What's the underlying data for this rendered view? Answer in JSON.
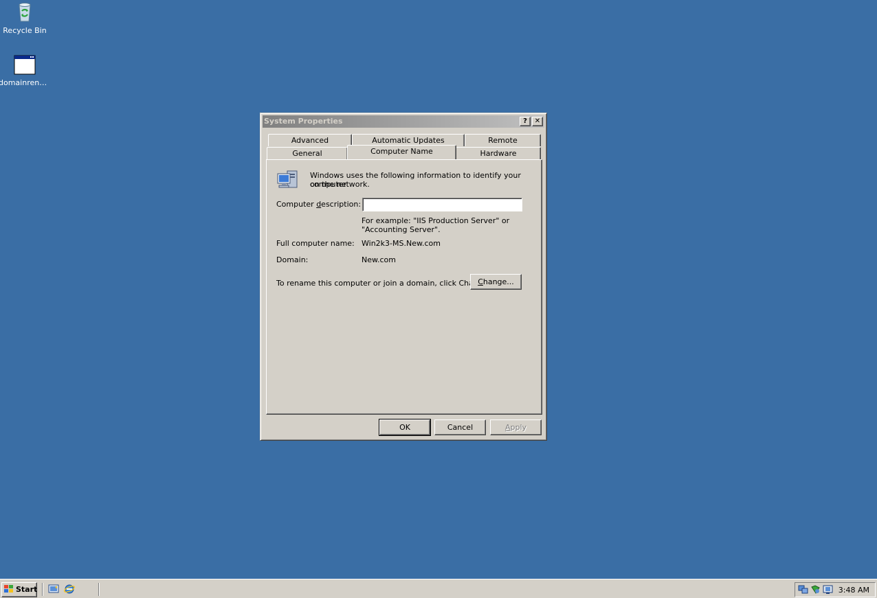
{
  "desktop": {
    "icons": [
      {
        "label": "Recycle Bin"
      },
      {
        "label": "domainrena..."
      }
    ]
  },
  "dialog": {
    "title": "System Properties",
    "help_btn": "?",
    "close_btn": "✕",
    "tabs": [
      "Advanced",
      "Automatic Updates",
      "Remote",
      "General",
      "Computer Name",
      "Hardware"
    ],
    "active_tab": "Computer Name",
    "intro_line1": "Windows uses the following information to identify your computer",
    "intro_line2": "on the network.",
    "desc_label_pre": "Computer ",
    "desc_label_u": "d",
    "desc_label_post": "escription:",
    "desc_value": "",
    "example_line1": "For example: \"IIS Production Server\" or",
    "example_line2": "\"Accounting Server\".",
    "full_name_label": "Full computer name:",
    "full_name_value": "Win2k3-MS.New.com",
    "domain_label": "Domain:",
    "domain_value": "New.com",
    "rename_text": "To rename this computer or join a domain, click Change.",
    "change_btn_u": "C",
    "change_btn_rest": "hange...",
    "ok_btn": "OK",
    "cancel_btn": "Cancel",
    "apply_btn_u": "A",
    "apply_btn_rest": "pply"
  },
  "taskbar": {
    "start_label": "Start",
    "clock": "3:48 AM"
  },
  "colors": {
    "desktop": "#3a6ea5",
    "face": "#d4d0c8"
  }
}
